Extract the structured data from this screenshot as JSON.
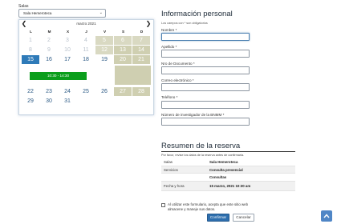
{
  "salas": {
    "label": "Salas",
    "selected": "Sala Hemeroteca",
    "caret": "⌄"
  },
  "calendar": {
    "title": "marzo 2021",
    "prev": "❮",
    "next": "❯",
    "weekdays": [
      "L",
      "M",
      "X",
      "J",
      "V",
      "S",
      "D"
    ],
    "weeks_top": [
      [
        "1",
        "2",
        "3",
        "4",
        "5",
        "6",
        "7"
      ],
      [
        "8",
        "9",
        "10",
        "11",
        "12",
        "13",
        "14"
      ],
      [
        "15",
        "16",
        "17",
        "18",
        "19",
        "20",
        "21"
      ]
    ],
    "weeks_bottom": [
      [
        "22",
        "23",
        "24",
        "25",
        "26",
        "27",
        "28"
      ],
      [
        "29",
        "30",
        "31"
      ]
    ],
    "slot": "10:30 - 14:30"
  },
  "form": {
    "title": "Información personal",
    "required_note": "Los campos con * son obligatorios",
    "fields": [
      {
        "label": "Nombre *",
        "value": ""
      },
      {
        "label": "Apellido *",
        "value": ""
      },
      {
        "label": "Nro de Documento *",
        "value": ""
      },
      {
        "label": "Correo electrónico *",
        "value": ""
      },
      {
        "label": "Teléfono *",
        "value": ""
      },
      {
        "label": "Número de investigador de la BNMM *",
        "value": ""
      }
    ]
  },
  "resumen": {
    "title": "Resumen de la reserva",
    "note": "Por favor, revise los datos de la reserva antes de confirmarla.",
    "rows": [
      {
        "key": "Salas",
        "value": "Sala Hemeroteca"
      },
      {
        "key": "Servicios",
        "value": "Consulta presencial"
      },
      {
        "key": "",
        "value": "Consultas"
      },
      {
        "key": "Fecha y hora",
        "value": "15 marzo, 2021 10:30 am"
      }
    ],
    "consent": "Al utilizar este formulario, acepta que este sitio web almacene y maneje sus datos.",
    "confirm": "Confirmar",
    "cancel": "Cancelar"
  },
  "colors": {
    "selected_day": "#2e7ab8",
    "slot_green": "#0b9e1c",
    "unavailable_olive": "#cfcfb1",
    "confirm_button": "#2e6fae"
  },
  "icons": {
    "prev": "chevron-left-icon",
    "next": "chevron-right-icon",
    "scroll_top": "arrow-up-icon"
  }
}
